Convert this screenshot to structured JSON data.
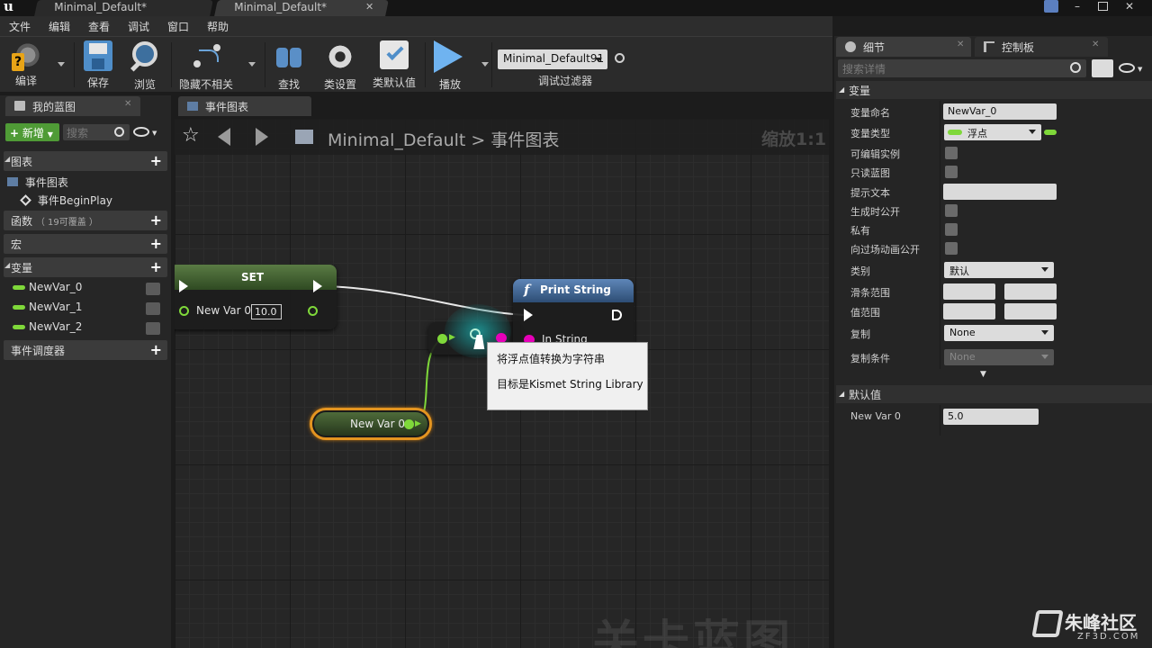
{
  "title_tabs": [
    {
      "label": "Minimal_Default*"
    },
    {
      "label": "Minimal_Default*"
    }
  ],
  "menu": [
    "文件",
    "编辑",
    "查看",
    "调试",
    "窗口",
    "帮助"
  ],
  "toolbar": {
    "compile": "编译",
    "save": "保存",
    "browse": "浏览",
    "hide_unrelated": "隐藏不相关",
    "find": "查找",
    "class_settings": "类设置",
    "class_defaults": "类默认值",
    "play": "播放",
    "debug_object": "Minimal_Default91",
    "debug_filter": "调试过滤器"
  },
  "my_blueprint": {
    "tab_label": "我的蓝图",
    "add_new": "新增",
    "search_placeholder": "搜索",
    "graphs_label": "图表",
    "event_graph": "事件图表",
    "begin_play": "事件BeginPlay",
    "functions_label": "函数",
    "functions_override": "（ 19可覆盖 ）",
    "macros_label": "宏",
    "variables_label": "变量",
    "variables": [
      {
        "name": "NewVar_0"
      },
      {
        "name": "NewVar_1"
      },
      {
        "name": "NewVar_2"
      }
    ],
    "dispatchers_label": "事件调度器"
  },
  "graph": {
    "tab_label": "事件图表",
    "breadcrumb_root": "Minimal_Default",
    "breadcrumb_sep": ">",
    "breadcrumb_current": "事件图表",
    "zoom": "缩放1:1",
    "watermark": "关卡蓝图",
    "set_node": {
      "title": "SET",
      "pin_label": "New Var 0",
      "value": "10.0"
    },
    "print_node": {
      "title": "Print String",
      "pin_label": "In String"
    },
    "getter_node": {
      "label": "New Var 0"
    },
    "tooltip": {
      "line1": "将浮点值转换为字符串",
      "line2": "目标是Kismet String Library"
    }
  },
  "details": {
    "tab_details": "细节",
    "tab_palette": "控制板",
    "search_placeholder": "搜索详情",
    "variable_section": "变量",
    "props": {
      "var_name_label": "变量命名",
      "var_name_value": "NewVar_0",
      "var_type_label": "变量类型",
      "var_type_value": "浮点",
      "instance_editable": "可编辑实例",
      "blueprint_readonly": "只读蓝图",
      "tooltip_label": "提示文本",
      "expose_spawn": "生成时公开",
      "private": "私有",
      "expose_cinematics": "向过场动画公开",
      "category_label": "类别",
      "category_value": "默认",
      "slider_range": "滑条范围",
      "value_range": "值范围",
      "replication_label": "复制",
      "replication_value": "None",
      "replication_cond_label": "复制条件",
      "replication_cond_value": "None"
    },
    "default_section": "默认值",
    "default_var_label": "New Var 0",
    "default_var_value": "5.0"
  },
  "brand": {
    "name": "朱峰社区",
    "url": "ZF3D.COM"
  },
  "colors": {
    "float_pin": "#7fd83a",
    "string_pin": "#e600b8",
    "print_header": "#3b5d86",
    "set_header": "#3d5b2a",
    "getter_outline": "#e39420"
  }
}
